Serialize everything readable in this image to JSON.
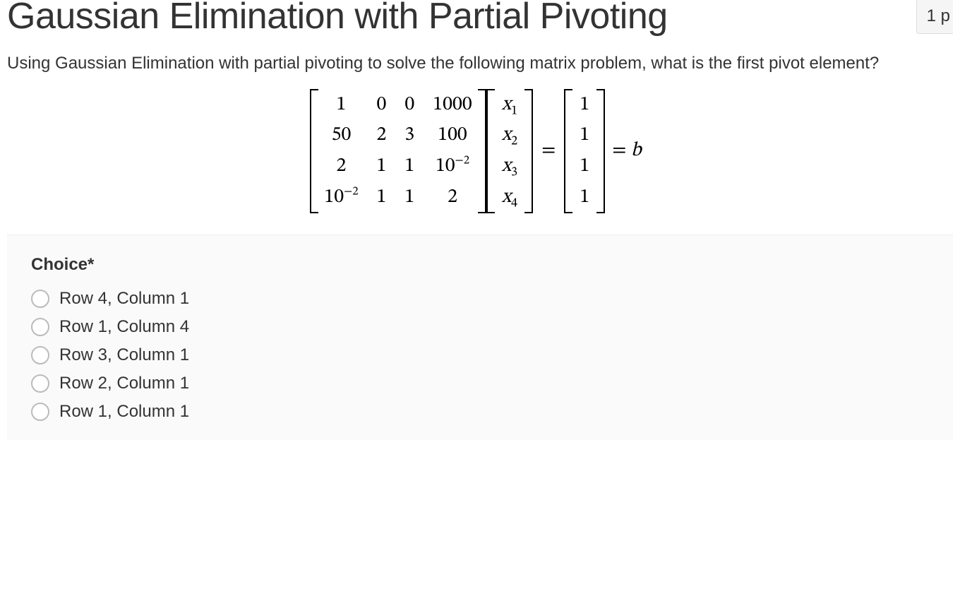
{
  "title": "Gaussian Elimination with Partial Pivoting",
  "points_fragment": "1 p",
  "prompt": "Using Gaussian Elimination with partial pivoting to solve the following matrix problem, what is the first pivot element?",
  "equation": {
    "A": [
      [
        "1",
        "0",
        "0",
        "1000"
      ],
      [
        "50",
        "2",
        "3",
        "100"
      ],
      [
        "2",
        "1",
        "1",
        "10^{-2}"
      ],
      [
        "10^{-2}",
        "1",
        "1",
        "2"
      ]
    ],
    "x": [
      "x_1",
      "x_2",
      "x_3",
      "x_4"
    ],
    "b": [
      "1",
      "1",
      "1",
      "1"
    ],
    "rhs_label": "= b"
  },
  "choices": {
    "heading": "Choice*",
    "options": [
      "Row 4, Column 1",
      "Row 1, Column 4",
      "Row 3, Column 1",
      "Row 2, Column 1",
      "Row 1, Column 1"
    ]
  }
}
